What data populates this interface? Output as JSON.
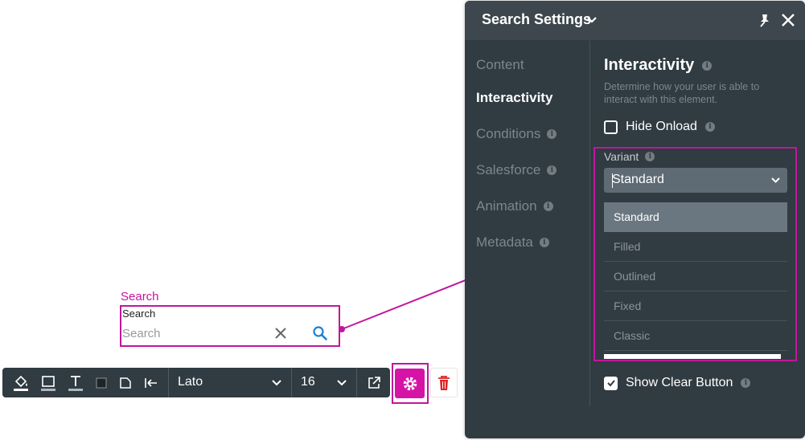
{
  "canvas": {
    "label": "Search",
    "inner_label": "Search",
    "placeholder": "Search"
  },
  "toolbar": {
    "font": "Lato",
    "size": "16"
  },
  "panel": {
    "title": "Search Settings",
    "nav": [
      {
        "label": "Content"
      },
      {
        "label": "Interactivity"
      },
      {
        "label": "Conditions"
      },
      {
        "label": "Salesforce"
      },
      {
        "label": "Animation"
      },
      {
        "label": "Metadata"
      }
    ],
    "section_title": "Interactivity",
    "section_desc": "Determine how your user is able to interact with this element.",
    "hide_onload": "Hide Onload",
    "variant_label": "Variant",
    "variant_value": "Standard",
    "variant_options": [
      "Standard",
      "Filled",
      "Outlined",
      "Fixed",
      "Classic"
    ],
    "show_clear": "Show Clear Button",
    "info": "i"
  },
  "colors": {
    "accent": "#c2169e",
    "panel_bg": "#303b42",
    "gear_bg": "#d613a7",
    "trash": "#e02424"
  }
}
